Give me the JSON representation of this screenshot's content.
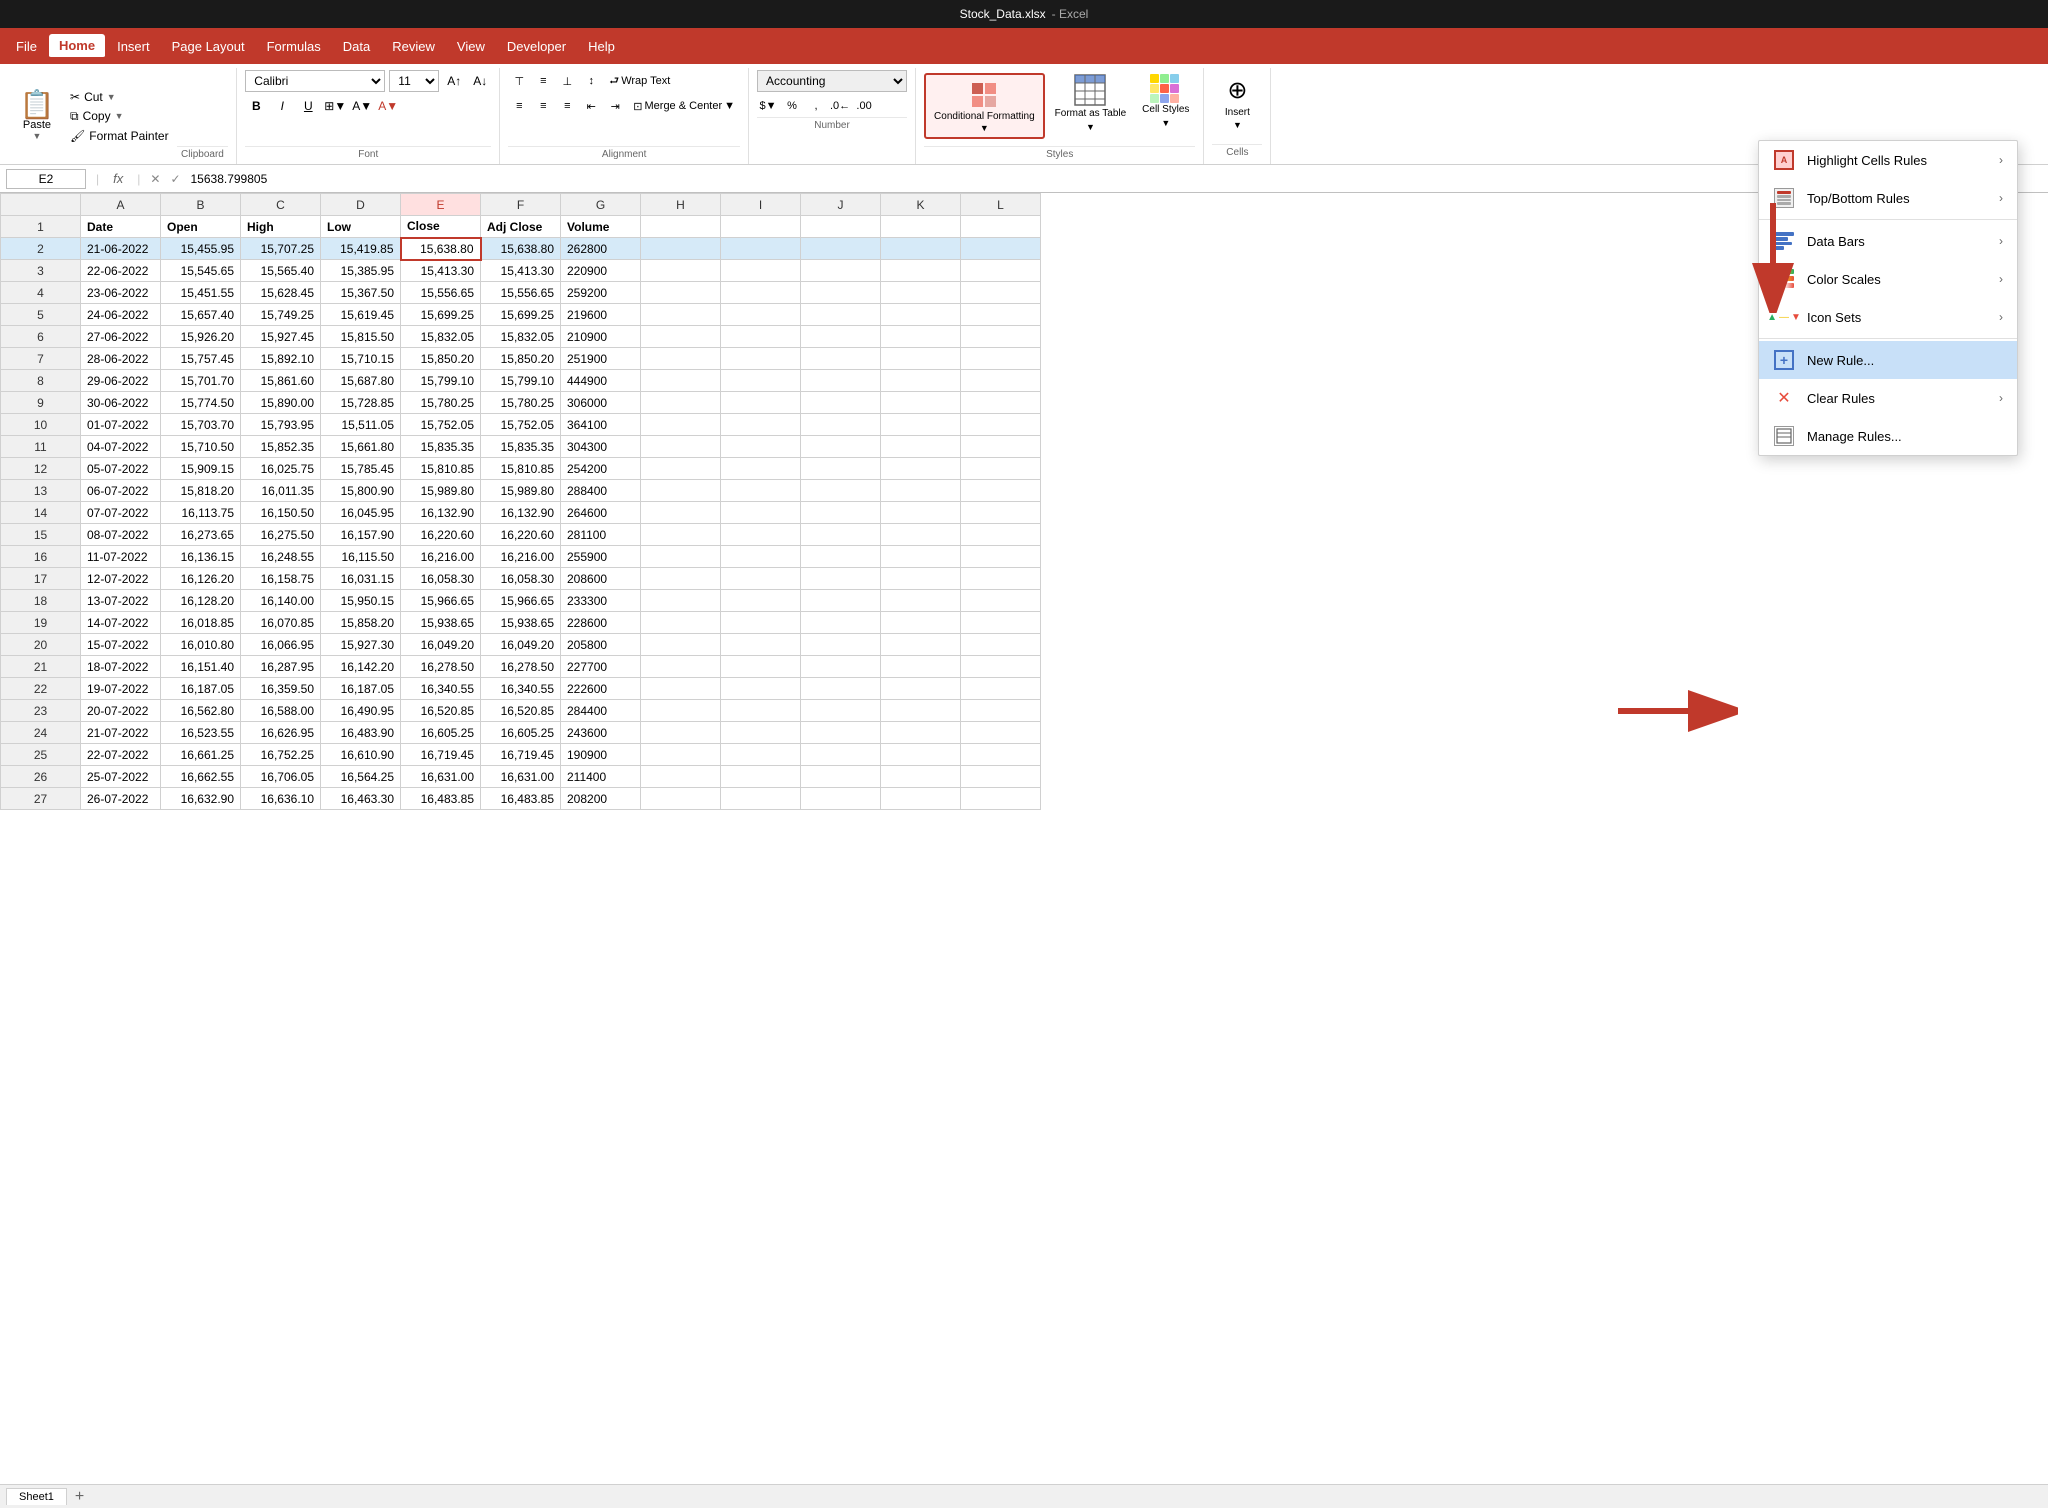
{
  "app": {
    "title": "Microsoft Excel",
    "file": "Stock_Data.xlsx"
  },
  "menu": {
    "items": [
      "File",
      "Home",
      "Insert",
      "Page Layout",
      "Formulas",
      "Data",
      "Review",
      "View",
      "Developer",
      "Help"
    ],
    "active": "Home"
  },
  "ribbon": {
    "clipboard": {
      "paste_label": "Paste",
      "cut_label": "Cut",
      "copy_label": "Copy",
      "format_painter_label": "Format Painter",
      "group_label": "Clipboard"
    },
    "font": {
      "font_name": "Calibri",
      "font_size": "11",
      "bold_label": "B",
      "italic_label": "I",
      "underline_label": "U",
      "group_label": "Font"
    },
    "alignment": {
      "wrap_text_label": "Wrap Text",
      "merge_center_label": "Merge & Center",
      "group_label": "Alignment"
    },
    "number": {
      "format": "Accounting",
      "group_label": "Number"
    },
    "styles": {
      "conditional_format_label": "Conditional\nFormatting",
      "format_table_label": "Format as\nTable",
      "cell_styles_label": "Cell\nStyles",
      "group_label": "Styles"
    },
    "cells": {
      "insert_label": "Insert",
      "group_label": "Cells"
    }
  },
  "formula_bar": {
    "name_box": "E2",
    "formula": "15638.799805",
    "fx": "fx"
  },
  "columns": {
    "headers": [
      "",
      "A",
      "B",
      "C",
      "D",
      "E",
      "F",
      "G",
      "H",
      "I",
      "J",
      "K",
      "L"
    ],
    "col_labels": [
      "Date",
      "Open",
      "High",
      "Low",
      "Close",
      "Adj Close",
      "Volume"
    ]
  },
  "rows": [
    {
      "row": 1,
      "date": "Date",
      "open": "Open",
      "high": "High",
      "low": "Low",
      "close": "Close",
      "adj_close": "Adj Close",
      "volume": "Volume"
    },
    {
      "row": 2,
      "date": "21-06-2022",
      "open": "15,455.95",
      "high": "15,707.25",
      "low": "15,419.85",
      "close": "15,638.80",
      "adj_close": "15,638.80",
      "volume": "262800"
    },
    {
      "row": 3,
      "date": "22-06-2022",
      "open": "15,545.65",
      "high": "15,565.40",
      "low": "15,385.95",
      "close": "15,413.30",
      "adj_close": "15,413.30",
      "volume": "220900"
    },
    {
      "row": 4,
      "date": "23-06-2022",
      "open": "15,451.55",
      "high": "15,628.45",
      "low": "15,367.50",
      "close": "15,556.65",
      "adj_close": "15,556.65",
      "volume": "259200"
    },
    {
      "row": 5,
      "date": "24-06-2022",
      "open": "15,657.40",
      "high": "15,749.25",
      "low": "15,619.45",
      "close": "15,699.25",
      "adj_close": "15,699.25",
      "volume": "219600"
    },
    {
      "row": 6,
      "date": "27-06-2022",
      "open": "15,926.20",
      "high": "15,927.45",
      "low": "15,815.50",
      "close": "15,832.05",
      "adj_close": "15,832.05",
      "volume": "210900"
    },
    {
      "row": 7,
      "date": "28-06-2022",
      "open": "15,757.45",
      "high": "15,892.10",
      "low": "15,710.15",
      "close": "15,850.20",
      "adj_close": "15,850.20",
      "volume": "251900"
    },
    {
      "row": 8,
      "date": "29-06-2022",
      "open": "15,701.70",
      "high": "15,861.60",
      "low": "15,687.80",
      "close": "15,799.10",
      "adj_close": "15,799.10",
      "volume": "444900"
    },
    {
      "row": 9,
      "date": "30-06-2022",
      "open": "15,774.50",
      "high": "15,890.00",
      "low": "15,728.85",
      "close": "15,780.25",
      "adj_close": "15,780.25",
      "volume": "306000"
    },
    {
      "row": 10,
      "date": "01-07-2022",
      "open": "15,703.70",
      "high": "15,793.95",
      "low": "15,511.05",
      "close": "15,752.05",
      "adj_close": "15,752.05",
      "volume": "364100"
    },
    {
      "row": 11,
      "date": "04-07-2022",
      "open": "15,710.50",
      "high": "15,852.35",
      "low": "15,661.80",
      "close": "15,835.35",
      "adj_close": "15,835.35",
      "volume": "304300"
    },
    {
      "row": 12,
      "date": "05-07-2022",
      "open": "15,909.15",
      "high": "16,025.75",
      "low": "15,785.45",
      "close": "15,810.85",
      "adj_close": "15,810.85",
      "volume": "254200"
    },
    {
      "row": 13,
      "date": "06-07-2022",
      "open": "15,818.20",
      "high": "16,011.35",
      "low": "15,800.90",
      "close": "15,989.80",
      "adj_close": "15,989.80",
      "volume": "288400"
    },
    {
      "row": 14,
      "date": "07-07-2022",
      "open": "16,113.75",
      "high": "16,150.50",
      "low": "16,045.95",
      "close": "16,132.90",
      "adj_close": "16,132.90",
      "volume": "264600"
    },
    {
      "row": 15,
      "date": "08-07-2022",
      "open": "16,273.65",
      "high": "16,275.50",
      "low": "16,157.90",
      "close": "16,220.60",
      "adj_close": "16,220.60",
      "volume": "281100"
    },
    {
      "row": 16,
      "date": "11-07-2022",
      "open": "16,136.15",
      "high": "16,248.55",
      "low": "16,115.50",
      "close": "16,216.00",
      "adj_close": "16,216.00",
      "volume": "255900"
    },
    {
      "row": 17,
      "date": "12-07-2022",
      "open": "16,126.20",
      "high": "16,158.75",
      "low": "16,031.15",
      "close": "16,058.30",
      "adj_close": "16,058.30",
      "volume": "208600"
    },
    {
      "row": 18,
      "date": "13-07-2022",
      "open": "16,128.20",
      "high": "16,140.00",
      "low": "15,950.15",
      "close": "15,966.65",
      "adj_close": "15,966.65",
      "volume": "233300"
    },
    {
      "row": 19,
      "date": "14-07-2022",
      "open": "16,018.85",
      "high": "16,070.85",
      "low": "15,858.20",
      "close": "15,938.65",
      "adj_close": "15,938.65",
      "volume": "228600"
    },
    {
      "row": 20,
      "date": "15-07-2022",
      "open": "16,010.80",
      "high": "16,066.95",
      "low": "15,927.30",
      "close": "16,049.20",
      "adj_close": "16,049.20",
      "volume": "205800"
    },
    {
      "row": 21,
      "date": "18-07-2022",
      "open": "16,151.40",
      "high": "16,287.95",
      "low": "16,142.20",
      "close": "16,278.50",
      "adj_close": "16,278.50",
      "volume": "227700"
    },
    {
      "row": 22,
      "date": "19-07-2022",
      "open": "16,187.05",
      "high": "16,359.50",
      "low": "16,187.05",
      "close": "16,340.55",
      "adj_close": "16,340.55",
      "volume": "222600"
    },
    {
      "row": 23,
      "date": "20-07-2022",
      "open": "16,562.80",
      "high": "16,588.00",
      "low": "16,490.95",
      "close": "16,520.85",
      "adj_close": "16,520.85",
      "volume": "284400"
    },
    {
      "row": 24,
      "date": "21-07-2022",
      "open": "16,523.55",
      "high": "16,626.95",
      "low": "16,483.90",
      "close": "16,605.25",
      "adj_close": "16,605.25",
      "volume": "243600"
    },
    {
      "row": 25,
      "date": "22-07-2022",
      "open": "16,661.25",
      "high": "16,752.25",
      "low": "16,610.90",
      "close": "16,719.45",
      "adj_close": "16,719.45",
      "volume": "190900"
    },
    {
      "row": 26,
      "date": "25-07-2022",
      "open": "16,662.55",
      "high": "16,706.05",
      "low": "16,564.25",
      "close": "16,631.00",
      "adj_close": "16,631.00",
      "volume": "211400"
    },
    {
      "row": 27,
      "date": "26-07-2022",
      "open": "16,632.90",
      "high": "16,636.10",
      "low": "16,463.30",
      "close": "16,483.85",
      "adj_close": "16,483.85",
      "volume": "208200"
    }
  ],
  "dropdown": {
    "title": "Conditional Formatting",
    "items": [
      {
        "id": "highlight",
        "label": "Highlight Cells Rules",
        "has_arrow": true,
        "icon": "highlight"
      },
      {
        "id": "topbottom",
        "label": "Top/Bottom Rules",
        "has_arrow": true,
        "icon": "topbottom"
      },
      {
        "id": "databars",
        "label": "Data Bars",
        "has_arrow": true,
        "icon": "databars"
      },
      {
        "id": "colorscales",
        "label": "Color Scales",
        "has_arrow": true,
        "icon": "colorscales"
      },
      {
        "id": "iconsets",
        "label": "Icon Sets",
        "has_arrow": true,
        "icon": "iconsets"
      },
      {
        "id": "newrule",
        "label": "New Rule...",
        "has_arrow": false,
        "icon": "newrule",
        "highlighted": true
      },
      {
        "id": "clearrules",
        "label": "Clear Rules",
        "has_arrow": true,
        "icon": "clearrules"
      },
      {
        "id": "managerules",
        "label": "Manage Rules...",
        "has_arrow": false,
        "icon": "managerules"
      }
    ]
  },
  "arrows": {
    "down_arrow": "⬇",
    "right_arrow": "➡"
  }
}
